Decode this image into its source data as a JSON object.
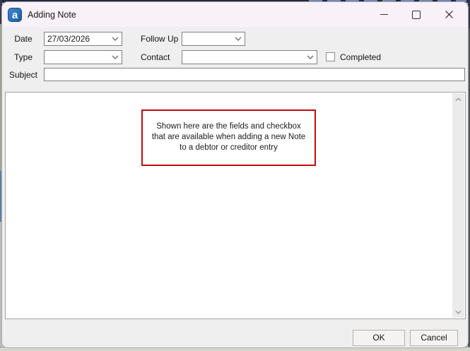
{
  "window": {
    "title": "Adding Note"
  },
  "form": {
    "date_label": "Date",
    "date_value": "27/03/2026",
    "follow_up_label": "Follow Up",
    "follow_up_value": "",
    "type_label": "Type",
    "type_value": "",
    "contact_label": "Contact",
    "contact_value": "",
    "completed_label": "Completed",
    "completed_checked": false,
    "subject_label": "Subject",
    "subject_value": ""
  },
  "note_area": {
    "annotation_lines": [
      "Shown here are the fields and checkbox",
      "that are available when adding a new Note",
      "to a debtor or creditor entry"
    ]
  },
  "footer": {
    "ok_label": "OK",
    "cancel_label": "Cancel"
  },
  "colors": {
    "titlebar_bg": "#f9f1f8",
    "dialog_bg": "#efefef",
    "app_icon_blue": "#2b7cc4",
    "annotation_border": "#c30b0b",
    "field_border": "#818181"
  }
}
